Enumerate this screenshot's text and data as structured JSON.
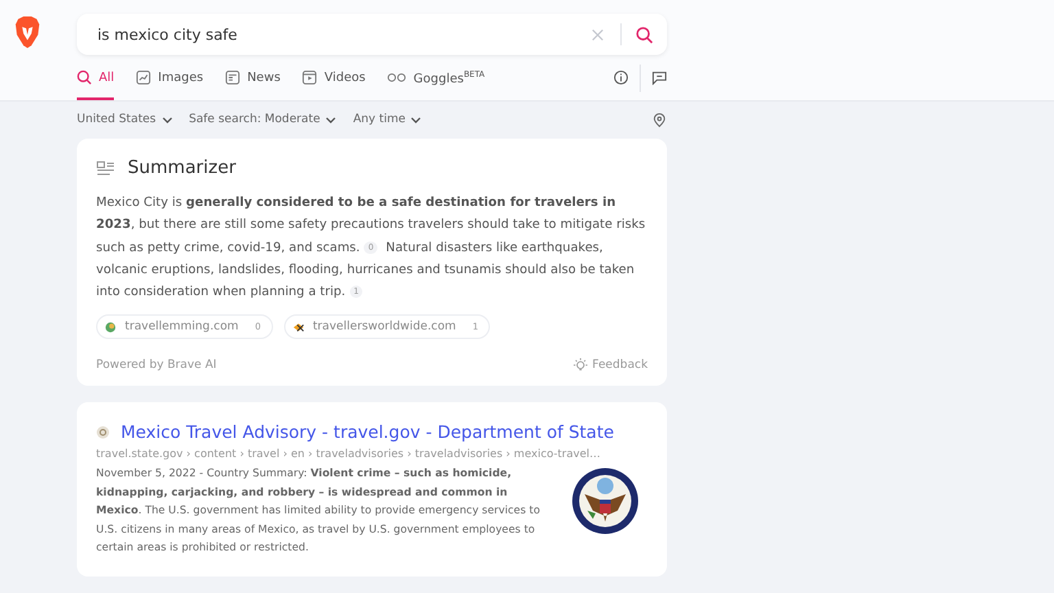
{
  "search": {
    "value": "is mexico city safe"
  },
  "tabs": [
    {
      "label": "All",
      "selected": true
    },
    {
      "label": "Images",
      "selected": false
    },
    {
      "label": "News",
      "selected": false
    },
    {
      "label": "Videos",
      "selected": false
    },
    {
      "label": "Goggles$^{BETA}$",
      "selected": false
    }
  ],
  "filters": [
    "United States",
    "Safe search: Moderate",
    "Any time"
  ],
  "summarizer": {
    "title": "Summarizer",
    "segments": [
      {
        "text": "Mexico City is **generally considered to be a safe destination for travelers in 2023**, but there are still some safety precautions travelers should take to mitigate risks such as petty crime, covid-19, and scams.",
        "cite": "0"
      },
      {
        "text": "Natural disasters like earthquakes, volcanic eruptions, landslides, flooding, hurricanes and tsunamis should also be taken into consideration when planning a trip.",
        "cite": "1"
      }
    ],
    "sources": [
      {
        "name": "travellemming.com",
        "count": "0"
      },
      {
        "name": "travellersworldwide.com",
        "count": "1"
      }
    ],
    "powered_by": "Powered by Brave AI",
    "feedback": "Feedback"
  },
  "result": {
    "title": "Mexico Travel Advisory - travel.gov - Department of State",
    "url": "travel.state.gov › content › travel › en › traveladvisories › traveladvisories › mexico-travel…",
    "snippet": "November 5, 2022 - Country Summary: **Violent crime – such as homicide, kidnapping, carjacking, and robbery – is widespread and common in Mexico**. The U.S. government has limited ability to provide emergency services to U.S. citizens in many areas of Mexico, as travel by U.S. government employees to certain areas is prohibited or restricted."
  }
}
